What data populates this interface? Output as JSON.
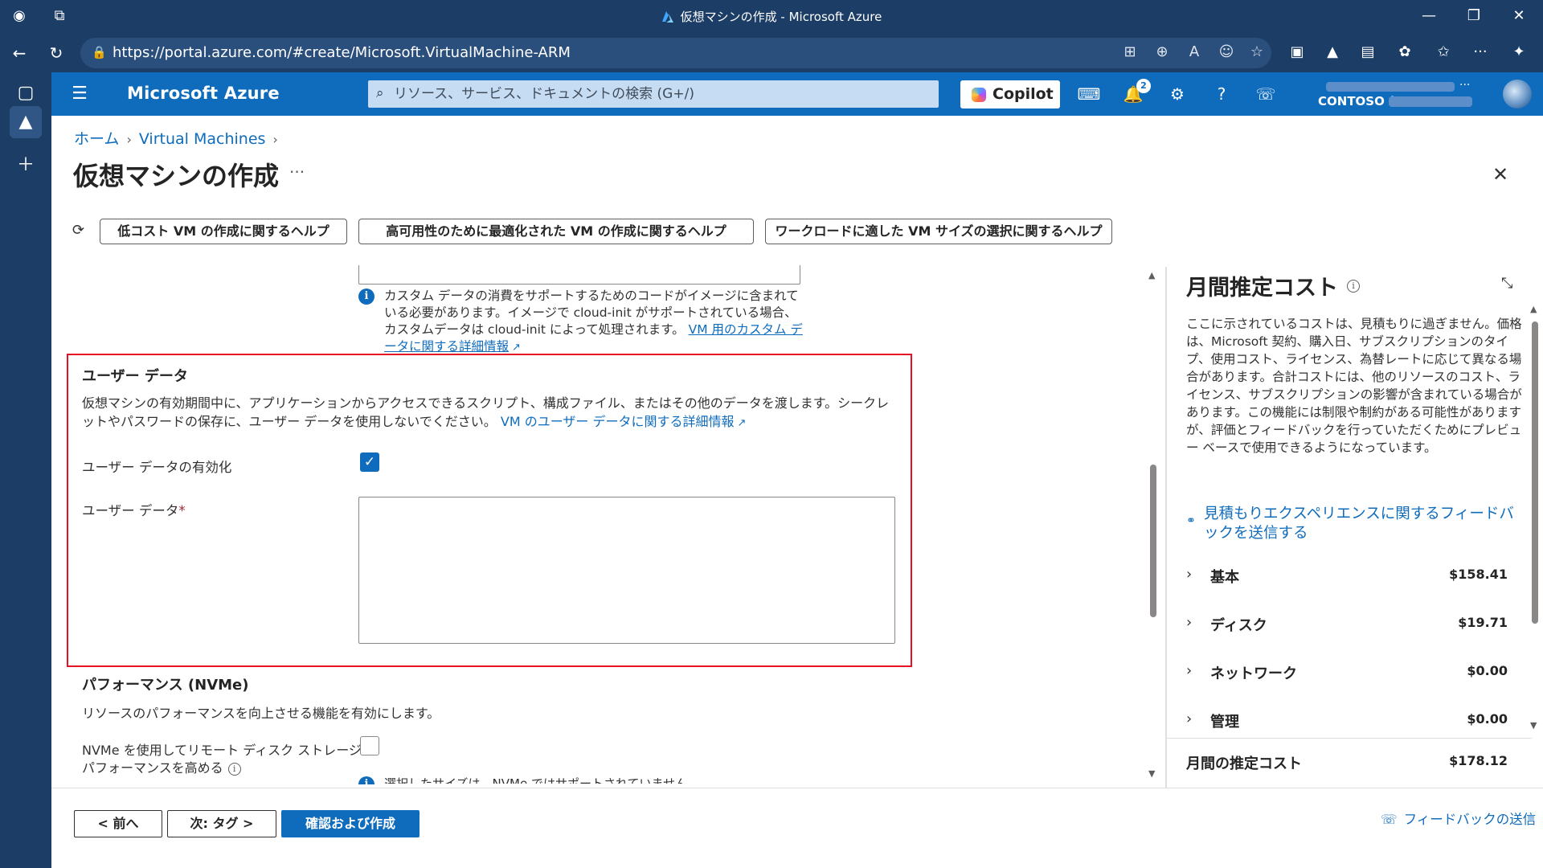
{
  "window": {
    "title": "仮想マシンの作成 - Microsoft Azure"
  },
  "browser": {
    "url": "https://portal.azure.com/#create/Microsoft.VirtualMachine-ARM"
  },
  "header": {
    "brand": "Microsoft Azure",
    "search_placeholder": "リソース、サービス、ドキュメントの検索 (G+/)",
    "copilot_label": "Copilot",
    "notification_count": "2",
    "tenant": "CONTOSO (",
    "accent_color": "#0f6cbd"
  },
  "breadcrumb": {
    "home": "ホーム",
    "vms": "Virtual Machines"
  },
  "page": {
    "title": "仮想マシンの作成",
    "more": "···"
  },
  "help_chips": [
    "低コスト VM の作成に関するヘルプ",
    "高可用性のために最適化された VM の作成に関するヘルプ",
    "ワークロードに適した VM サイズの選択に関するヘルプ"
  ],
  "custom_data_info": {
    "text": "カスタム データの消費をサポートするためのコードがイメージに含まれている必要があります。イメージで cloud-init がサポートされている場合、カスタムデータは cloud-init によって処理されます。",
    "link": "VM 用のカスタム データに関する詳細情報"
  },
  "user_data": {
    "heading": "ユーザー データ",
    "description": "仮想マシンの有効期間中に、アプリケーションからアクセスできるスクリプト、構成ファイル、またはその他のデータを渡します。シークレットやパスワードの保存に、ユーザー データを使用しないでください。",
    "link": "VM のユーザー データに関する詳細情報",
    "enable_label": "ユーザー データの有効化",
    "enable_checked": true,
    "field_label": "ユーザー データ",
    "required_mark": "*",
    "field_value": ""
  },
  "performance": {
    "heading": "パフォーマンス (NVMe)",
    "description": "リソースのパフォーマンスを向上させる機能を有効にします。",
    "nvme_label_line1": "NVMe を使用してリモート ディスク ストレージ",
    "nvme_label_line2": "パフォーマンスを高める",
    "nvme_checked": false,
    "cut_info": "選択したサイズは、NVMe ではサポートされていません。"
  },
  "cost": {
    "title": "月間推定コスト",
    "description": "ここに示されているコストは、見積もりに過ぎません。価格は、Microsoft 契約、購入日、サブスクリプションのタイプ、使用コスト、ライセンス、為替レートに応じて異なる場合があります。合計コストには、他のリソースのコスト、ライセンス、サブスクリプションの影響が含まれている場合があります。この機能には制限や制約がある可能性がありますが、評価とフィードバックを行っていただくためにプレビュー ベースで使用できるようになっています。",
    "feedback_link": "見積もりエクスペリエンスに関するフィードバックを送信する",
    "rows": [
      {
        "name": "基本",
        "amount": "$158.41"
      },
      {
        "name": "ディスク",
        "amount": "$19.71"
      },
      {
        "name": "ネットワーク",
        "amount": "$0.00"
      },
      {
        "name": "管理",
        "amount": "$0.00"
      }
    ],
    "total_label": "月間の推定コスト",
    "total_amount": "$178.12"
  },
  "footer": {
    "prev": "< 前へ",
    "next": "次: タグ >",
    "review": "確認および作成",
    "feedback": "フィードバックの送信"
  }
}
